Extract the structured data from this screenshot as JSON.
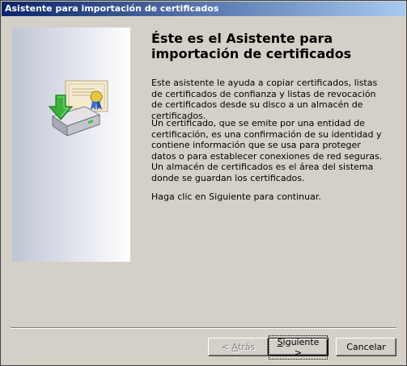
{
  "window": {
    "title": "Asistente para importación de certificados"
  },
  "main": {
    "heading": "Éste es el Asistente para importación de certificados",
    "paragraphs": [
      "Este asistente le ayuda a copiar certificados, listas de certificados de confianza y listas de revocación de certificados desde su disco a un almacén de certificados.",
      "Un certificado, que se emite por una entidad de certificación, es una confirmación de su identidad y contiene información que se usa para proteger datos o para establecer conexiones de red seguras. Un almacén de certificados es el área del sistema donde se guardan los certificados.",
      "Haga clic en Siguiente para continuar."
    ]
  },
  "buttons": {
    "back": {
      "prefix": "< ",
      "accel": "A",
      "rest": "trás",
      "enabled": false
    },
    "next": {
      "prefix": "",
      "accel": "S",
      "rest": "iguiente >",
      "enabled": true
    },
    "cancel": {
      "label": "Cancelar"
    }
  },
  "icons": {
    "wizard_graphic": "certificate-import-icon"
  },
  "colors": {
    "titlebar_start": "#0a246a",
    "titlebar_end": "#a6caf0",
    "face": "#d4d0c8"
  }
}
